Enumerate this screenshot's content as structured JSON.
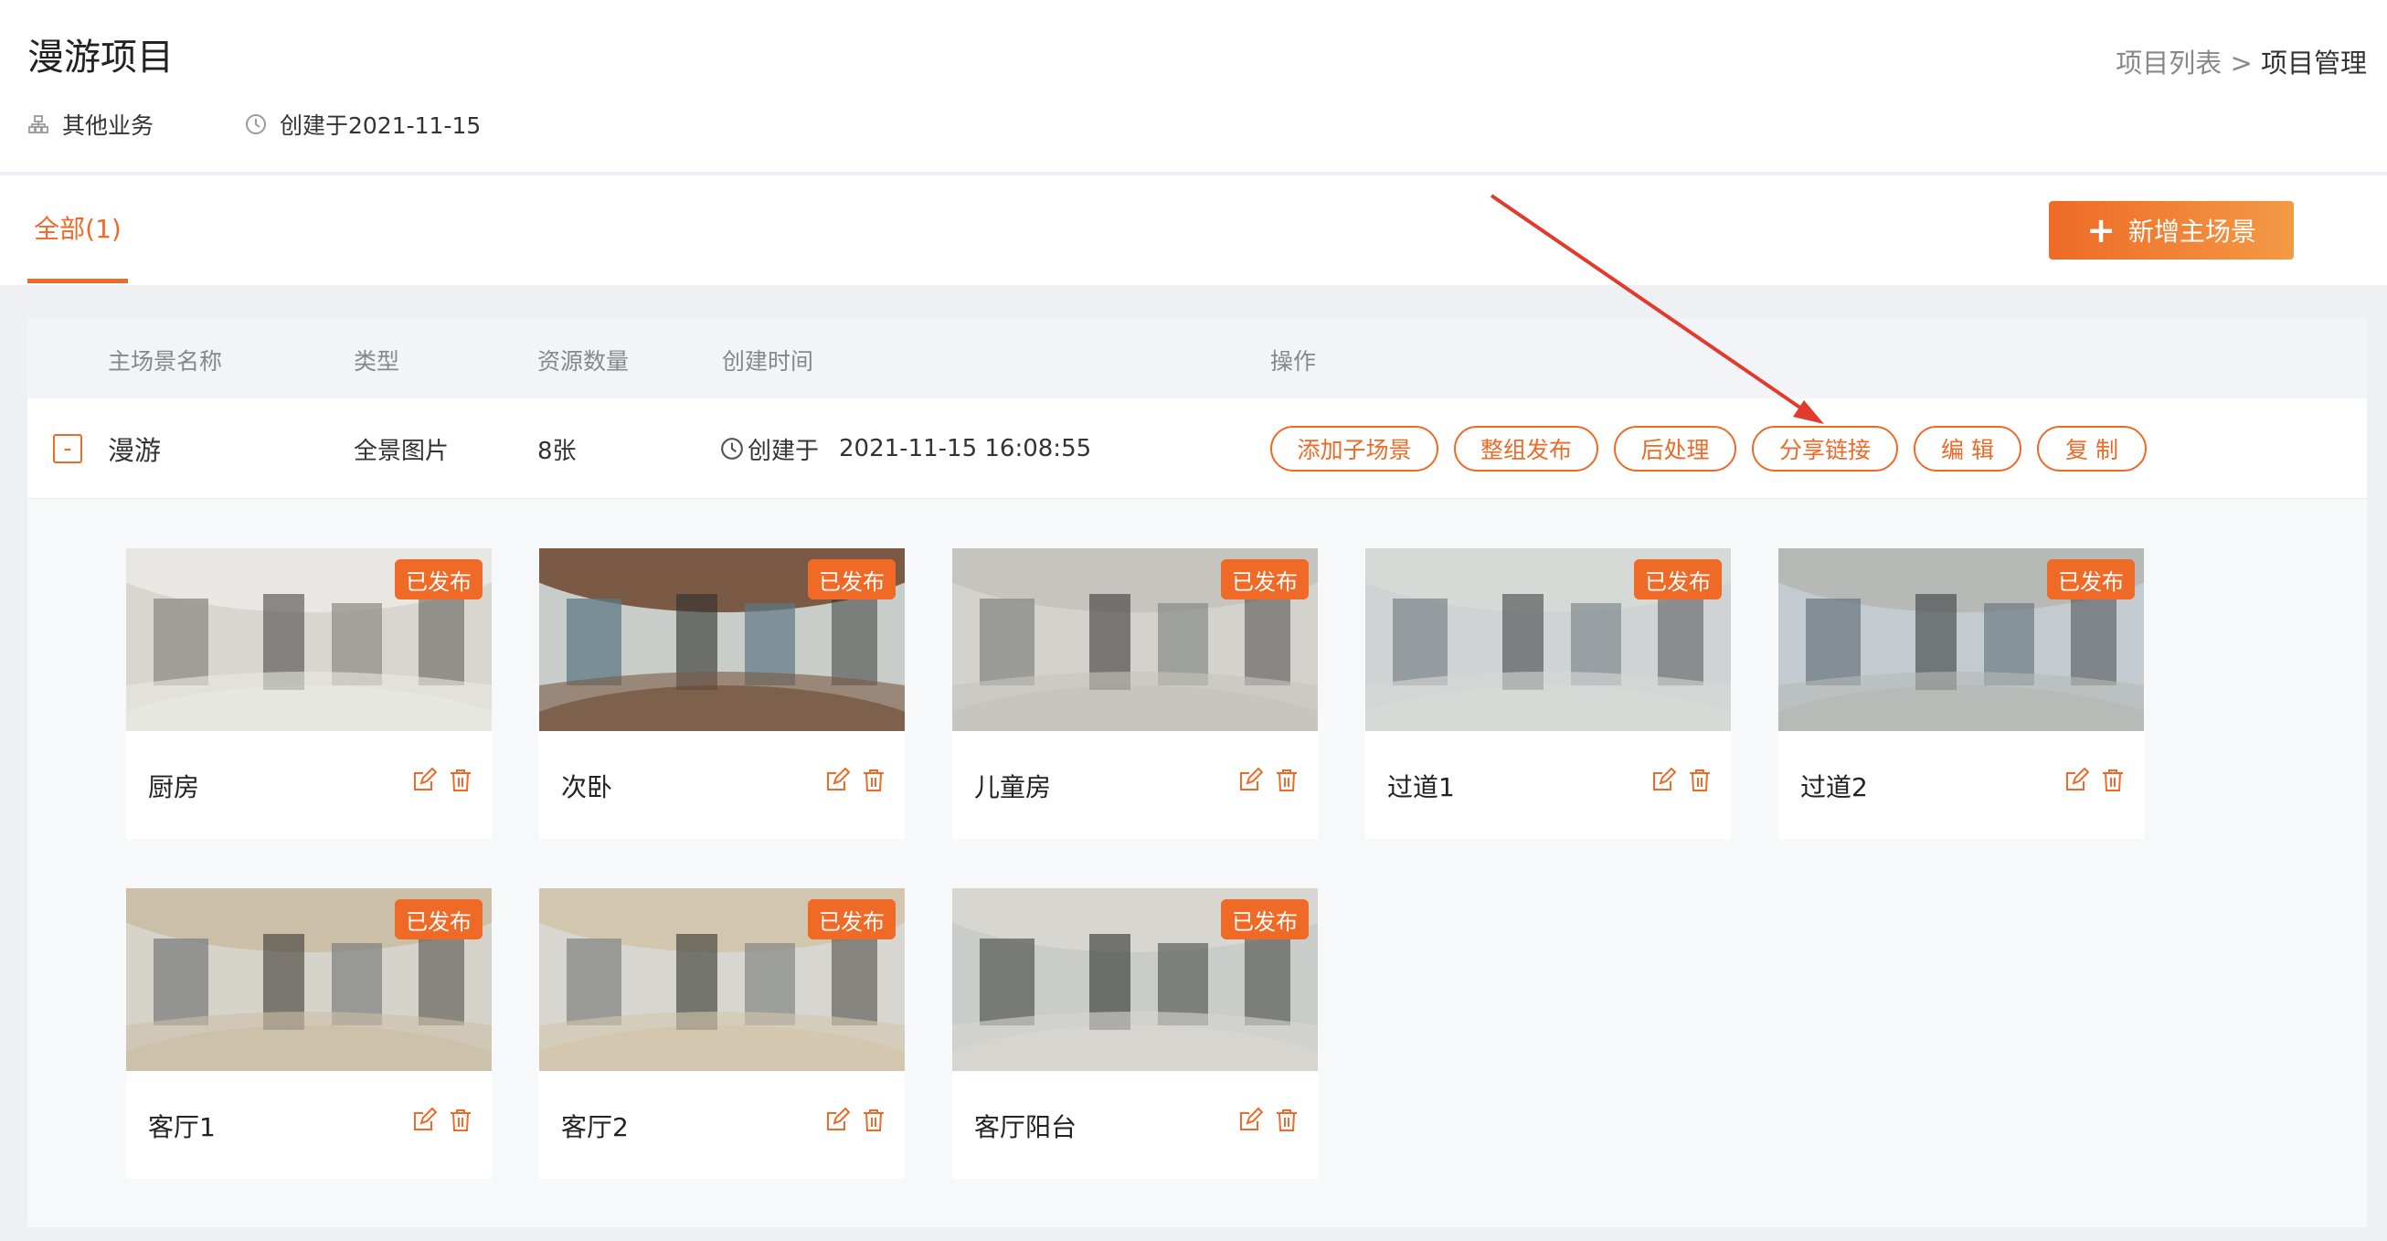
{
  "header": {
    "title": "漫游项目",
    "category": "其他业务",
    "created": "创建于2021-11-15",
    "breadcrumb": {
      "parent": "项目列表",
      "separator": " > ",
      "current": "项目管理"
    }
  },
  "tabs": {
    "all_label": "全部(1)"
  },
  "actions": {
    "add_main_scene": "新增主场景"
  },
  "table": {
    "headers": [
      "主场景名称",
      "类型",
      "资源数量",
      "创建时间",
      "操作"
    ],
    "row": {
      "collapse_symbol": "-",
      "name": "漫游",
      "type": "全景图片",
      "count": "8张",
      "created_prefix": "创建于",
      "created_time": "2021-11-15 16:08:55",
      "operations": [
        "添加子场景",
        "整组发布",
        "后处理",
        "分享链接",
        "编 辑",
        "复 制"
      ]
    }
  },
  "scenes": [
    {
      "name": "厨房",
      "status": "已发布"
    },
    {
      "name": "次卧",
      "status": "已发布"
    },
    {
      "name": "儿童房",
      "status": "已发布"
    },
    {
      "name": "过道1",
      "status": "已发布"
    },
    {
      "name": "过道2",
      "status": "已发布"
    },
    {
      "name": "客厅1",
      "status": "已发布"
    },
    {
      "name": "客厅2",
      "status": "已发布"
    },
    {
      "name": "客厅阳台",
      "status": "已发布"
    }
  ],
  "colors": {
    "accent": "#ee6a26",
    "annotation_arrow": "#e23b2e"
  },
  "icons": [
    "org-icon",
    "clock-icon",
    "plus-icon",
    "edit-icon",
    "trash-icon"
  ]
}
